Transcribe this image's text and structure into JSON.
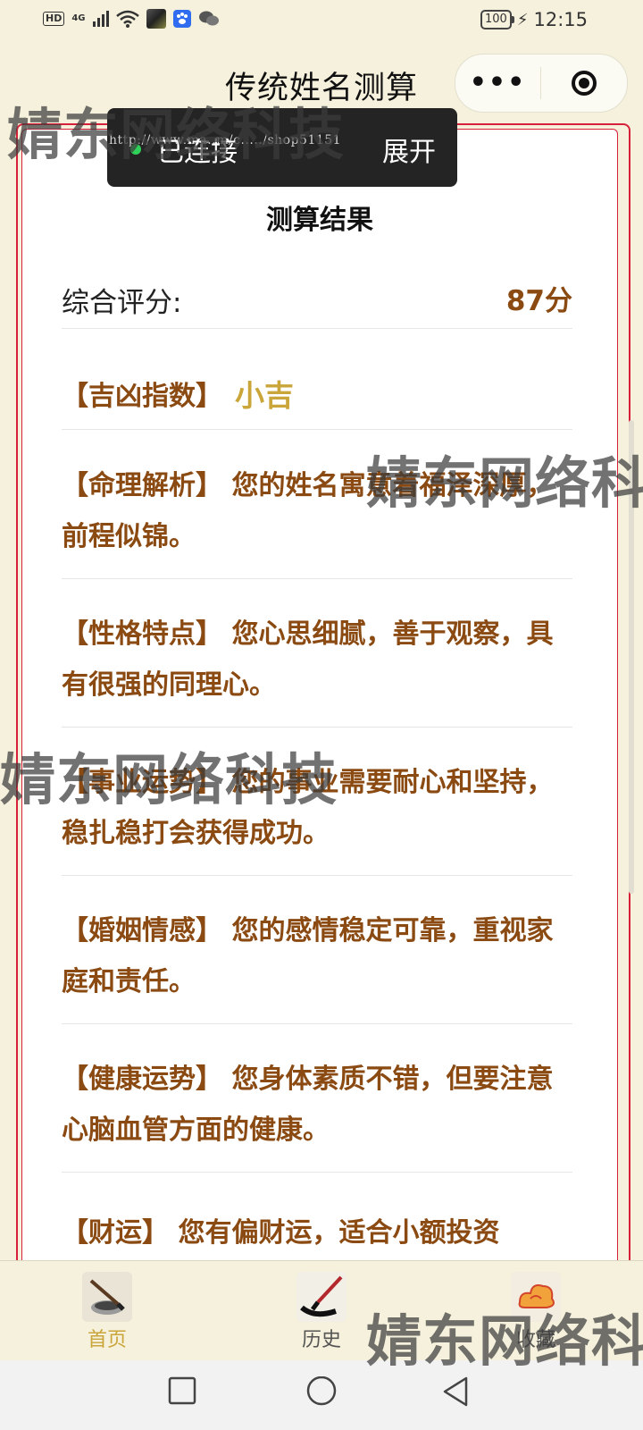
{
  "status_bar": {
    "hd": "HD",
    "net": "4G",
    "battery": "100",
    "time": "12:15",
    "icons": [
      "signal-icon",
      "wifi-icon",
      "app-thumbnail-icon",
      "baidu-icon",
      "wechat-icon",
      "charging-icon"
    ]
  },
  "header": {
    "title": "传统姓名测算",
    "more_label": "•••"
  },
  "toast": {
    "status": "已连接",
    "url": "http://www.ma..m/c...../shop51151",
    "expand": "展开"
  },
  "card": {
    "title": "测算结果",
    "score_label": "综合评分:",
    "score_value": "87分",
    "luck_key": "【吉凶指数】",
    "luck_value": "小吉",
    "items": [
      {
        "text": "【命理解析】 您的姓名寓意着福泽深厚，前程似锦。"
      },
      {
        "text": "【性格特点】 您心思细腻，善于观察，具有很强的同理心。"
      },
      {
        "text": "【事业运势】 您的事业需要耐心和坚持，稳扎稳打会获得成功。"
      },
      {
        "text": "【婚姻情感】 您的感情稳定可靠，重视家庭和责任。"
      },
      {
        "text": "【健康运势】 您身体素质不错，但要注意心脑血管方面的健康。"
      },
      {
        "text": "【财运】 您有偏财运，适合小额投资"
      }
    ]
  },
  "tabbar": {
    "tabs": [
      {
        "label": "首页",
        "icon": "brush-inkstone-icon"
      },
      {
        "label": "历史",
        "icon": "calligraphy-brush-icon"
      },
      {
        "label": "收藏",
        "icon": "auspicious-cloud-icon"
      }
    ]
  },
  "watermark": "婧东网络科技",
  "colors": {
    "background": "#f5f1dc",
    "frame_red": "#d7213b",
    "brown_text": "#8a4a12",
    "gold": "#c9a53a"
  }
}
